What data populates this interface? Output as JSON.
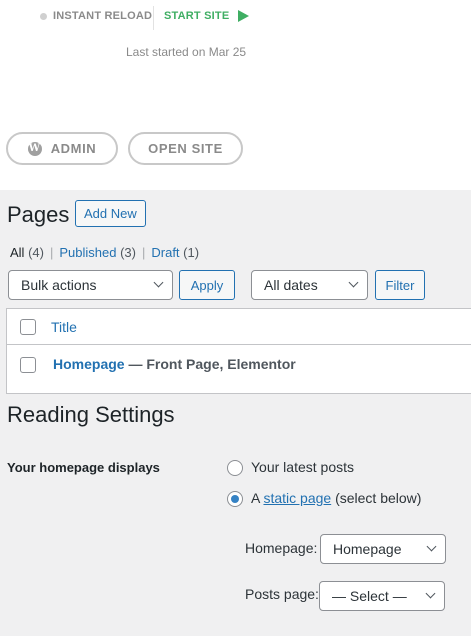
{
  "local_site": {
    "instant_reload_label": "INSTANT RELOAD",
    "start_site_label": "START SITE",
    "last_started": "Last started on Mar 25",
    "admin_label": "ADMIN",
    "open_site_label": "OPEN SITE",
    "colors": {
      "start": "#3fae63",
      "muted": "#8a8a8a"
    }
  },
  "pages": {
    "title": "Pages",
    "add_new_label": "Add New",
    "filters": [
      {
        "label": "All",
        "count": "(4)"
      },
      {
        "label": "Published",
        "count": "(3)"
      },
      {
        "label": "Draft",
        "count": "(1)"
      }
    ],
    "bulk_actions": "Bulk actions",
    "apply_label": "Apply",
    "dates_value": "All dates",
    "filter_label": "Filter",
    "table": {
      "column_title": "Title",
      "rows": [
        {
          "title": "Homepage",
          "states": " — Front Page, Elementor"
        }
      ]
    }
  },
  "reading": {
    "title": "Reading Settings",
    "homepage_displays_label": "Your homepage displays",
    "option_latest": "Your latest posts",
    "option_static_prefix": "A ",
    "option_static_link": "static page",
    "option_static_suffix": " (select below)",
    "selected_option": "static page",
    "homepage_label": "Homepage:",
    "homepage_value": "Homepage",
    "posts_page_label": "Posts page:",
    "posts_page_value": "— Select —"
  }
}
